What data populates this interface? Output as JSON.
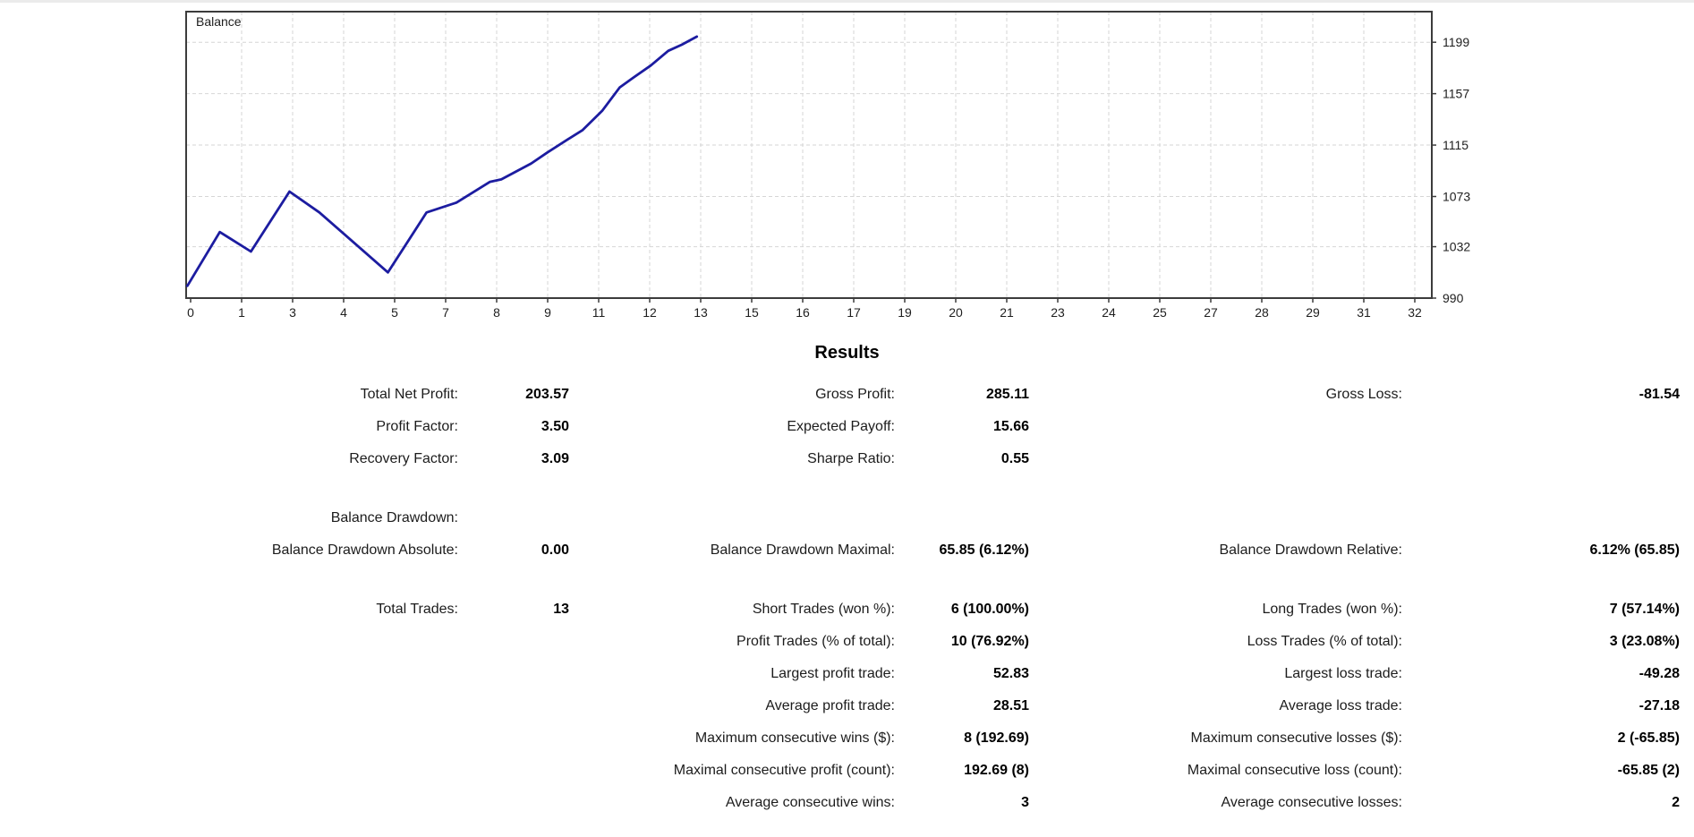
{
  "window": {
    "top_strip_color": "#ebebeb"
  },
  "chart_data": {
    "type": "line",
    "title": "Balance",
    "xlabel": "",
    "ylabel": "",
    "x_units": "fraction_of_plot_width",
    "x_tick_labels": [
      "0",
      "1",
      "3",
      "4",
      "5",
      "7",
      "8",
      "9",
      "11",
      "12",
      "13",
      "15",
      "16",
      "17",
      "19",
      "20",
      "21",
      "23",
      "24",
      "25",
      "27",
      "28",
      "29",
      "31",
      "32"
    ],
    "y_ticks": [
      990,
      1032,
      1073,
      1115,
      1157,
      1199
    ],
    "y_range": [
      990,
      1224
    ],
    "grid": true,
    "legend_position": "none",
    "grid_color": "#d6d6d6",
    "axis_color": "#3c3c3c",
    "series": [
      {
        "name": "Balance",
        "color": "#1c1ca0",
        "points": [
          [
            0.001,
            1000
          ],
          [
            0.027,
            1044
          ],
          [
            0.052,
            1028
          ],
          [
            0.083,
            1077
          ],
          [
            0.107,
            1060
          ],
          [
            0.162,
            1011
          ],
          [
            0.193,
            1060
          ],
          [
            0.217,
            1068
          ],
          [
            0.244,
            1085
          ],
          [
            0.253,
            1087
          ],
          [
            0.277,
            1100
          ],
          [
            0.29,
            1109
          ],
          [
            0.307,
            1120
          ],
          [
            0.318,
            1127
          ],
          [
            0.334,
            1143
          ],
          [
            0.348,
            1162
          ],
          [
            0.359,
            1170
          ],
          [
            0.373,
            1180
          ],
          [
            0.387,
            1192
          ],
          [
            0.398,
            1197
          ],
          [
            0.41,
            1203.57
          ]
        ]
      }
    ]
  },
  "results": {
    "title": "Results",
    "sections": [
      {
        "rows": [
          [
            {
              "l": "Total Net Profit:",
              "v": "203.57"
            },
            {
              "l": "Gross Profit:",
              "v": "285.11"
            },
            {
              "l": "Gross Loss:",
              "v": "-81.54"
            }
          ],
          [
            {
              "l": "Profit Factor:",
              "v": "3.50"
            },
            {
              "l": "Expected Payoff:",
              "v": "15.66"
            },
            null
          ],
          [
            {
              "l": "Recovery Factor:",
              "v": "3.09"
            },
            {
              "l": "Sharpe Ratio:",
              "v": "0.55"
            },
            null
          ]
        ]
      },
      {
        "rows": [
          [
            {
              "l": "Balance Drawdown:",
              "v": ""
            },
            null,
            null
          ],
          [
            {
              "l": "Balance Drawdown Absolute:",
              "v": "0.00"
            },
            {
              "l": "Balance Drawdown Maximal:",
              "v": "65.85 (6.12%)"
            },
            {
              "l": "Balance Drawdown Relative:",
              "v": "6.12% (65.85)"
            }
          ]
        ]
      },
      {
        "rows": [
          [
            {
              "l": "Total Trades:",
              "v": "13"
            },
            {
              "l": "Short Trades (won %):",
              "v": "6 (100.00%)"
            },
            {
              "l": "Long Trades (won %):",
              "v": "7 (57.14%)"
            }
          ],
          [
            null,
            {
              "l": "Profit Trades (% of total):",
              "v": "10 (76.92%)"
            },
            {
              "l": "Loss Trades (% of total):",
              "v": "3 (23.08%)"
            }
          ],
          [
            null,
            {
              "l": "Largest profit trade:",
              "v": "52.83"
            },
            {
              "l": "Largest loss trade:",
              "v": "-49.28"
            }
          ],
          [
            null,
            {
              "l": "Average profit trade:",
              "v": "28.51"
            },
            {
              "l": "Average loss trade:",
              "v": "-27.18"
            }
          ],
          [
            null,
            {
              "l": "Maximum consecutive wins ($):",
              "v": "8 (192.69)"
            },
            {
              "l": "Maximum consecutive losses ($):",
              "v": "2 (-65.85)"
            }
          ],
          [
            null,
            {
              "l": "Maximal consecutive profit (count):",
              "v": "192.69 (8)"
            },
            {
              "l": "Maximal consecutive loss (count):",
              "v": "-65.85 (2)"
            }
          ],
          [
            null,
            {
              "l": "Average consecutive wins:",
              "v": "3"
            },
            {
              "l": "Average consecutive losses:",
              "v": "2"
            }
          ]
        ]
      }
    ]
  }
}
